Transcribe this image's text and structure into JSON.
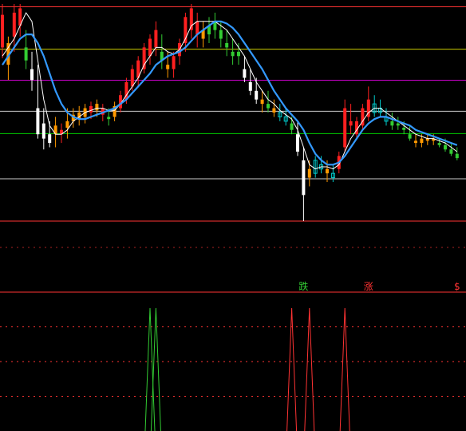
{
  "chart_data": [
    {
      "type": "candlestick",
      "panel": "main",
      "title": "",
      "xlabel": "",
      "ylabel": "",
      "ylim": [
        0,
        100
      ],
      "grid": false,
      "legend": "none",
      "colors": {
        "up": "#ff2020",
        "down": "#ffffff",
        "weak_up": "#ff9900",
        "weak_down": "#33cc33",
        "hollow": "#00cccc",
        "ma_fast": "#ffffff",
        "ma_slow": "#3399ff"
      },
      "reference_lines": [
        {
          "value": 98.7,
          "color": "#ff3333"
        },
        {
          "value": 79.2,
          "color": "#cccc00"
        },
        {
          "value": 64.9,
          "color": "#cc00cc"
        },
        {
          "value": 50.6,
          "color": "#cccccc"
        },
        {
          "value": 40.3,
          "color": "#00cc00"
        },
        {
          "value": 19.5,
          "color": "#cccccc"
        },
        {
          "value": 0.0,
          "color": "#ff3333"
        }
      ],
      "candles": [
        [
          0,
          80,
          100,
          75,
          95,
          "up"
        ],
        [
          1,
          72,
          85,
          65,
          82,
          "weak_up"
        ],
        [
          2,
          85,
          100,
          78,
          96,
          "up"
        ],
        [
          3,
          90,
          100,
          85,
          98,
          "up"
        ],
        [
          4,
          80,
          88,
          70,
          74,
          "weak_down"
        ],
        [
          5,
          70,
          78,
          60,
          65,
          "down"
        ],
        [
          6,
          52,
          72,
          38,
          40,
          "down"
        ],
        [
          7,
          45,
          52,
          33,
          38,
          "down"
        ],
        [
          8,
          40,
          46,
          34,
          36,
          "down"
        ],
        [
          9,
          40,
          48,
          34,
          44,
          "weak_up"
        ],
        [
          10,
          40,
          45,
          36,
          42,
          "up"
        ],
        [
          11,
          43,
          52,
          38,
          46,
          "weak_up"
        ],
        [
          12,
          46,
          52,
          43,
          49,
          "weak_up"
        ],
        [
          13,
          47,
          53,
          44,
          50,
          "weak_up"
        ],
        [
          14,
          48,
          54,
          45,
          52,
          "weak_up"
        ],
        [
          15,
          50,
          55,
          47,
          53,
          "up"
        ],
        [
          16,
          51,
          56,
          48,
          54,
          "weak_up"
        ],
        [
          17,
          49,
          54,
          46,
          52,
          "up"
        ],
        [
          18,
          47,
          52,
          44,
          48,
          "weak_down"
        ],
        [
          19,
          48,
          55,
          46,
          53,
          "weak_up"
        ],
        [
          20,
          52,
          60,
          50,
          58,
          "up"
        ],
        [
          21,
          56,
          66,
          54,
          64,
          "up"
        ],
        [
          22,
          62,
          72,
          60,
          70,
          "up"
        ],
        [
          23,
          66,
          76,
          62,
          74,
          "up"
        ],
        [
          24,
          70,
          82,
          68,
          80,
          "up"
        ],
        [
          25,
          76,
          86,
          72,
          84,
          "up"
        ],
        [
          26,
          80,
          92,
          76,
          88,
          "up"
        ],
        [
          27,
          78,
          86,
          70,
          74,
          "weak_down"
        ],
        [
          28,
          72,
          78,
          66,
          70,
          "weak_up"
        ],
        [
          29,
          70,
          78,
          66,
          76,
          "up"
        ],
        [
          30,
          76,
          84,
          72,
          82,
          "up"
        ],
        [
          31,
          82,
          96,
          78,
          94,
          "up"
        ],
        [
          32,
          88,
          100,
          84,
          98,
          "up"
        ],
        [
          33,
          86,
          96,
          80,
          92,
          "up"
        ],
        [
          34,
          84,
          92,
          80,
          88,
          "weak_up"
        ],
        [
          35,
          86,
          94,
          82,
          90,
          "weak_down"
        ],
        [
          36,
          88,
          96,
          84,
          92,
          "weak_down"
        ],
        [
          37,
          84,
          92,
          80,
          88,
          "weak_down"
        ],
        [
          38,
          82,
          88,
          76,
          80,
          "weak_down"
        ],
        [
          39,
          78,
          84,
          72,
          76,
          "weak_down"
        ],
        [
          40,
          76,
          82,
          72,
          78,
          "weak_down"
        ],
        [
          41,
          70,
          76,
          64,
          66,
          "down"
        ],
        [
          42,
          64,
          70,
          58,
          60,
          "down"
        ],
        [
          43,
          60,
          66,
          54,
          56,
          "down"
        ],
        [
          44,
          56,
          60,
          50,
          54,
          "weak_up"
        ],
        [
          45,
          54,
          60,
          50,
          52,
          "weak_down"
        ],
        [
          46,
          52,
          56,
          48,
          50,
          "weak_up"
        ],
        [
          47,
          50,
          54,
          46,
          48,
          "hollow"
        ],
        [
          48,
          48,
          52,
          44,
          46,
          "hollow"
        ],
        [
          49,
          45,
          48,
          40,
          42,
          "weak_down"
        ],
        [
          50,
          40,
          46,
          30,
          32,
          "down"
        ],
        [
          51,
          28,
          34,
          0,
          12,
          "down"
        ],
        [
          52,
          20,
          28,
          16,
          24,
          "weak_up"
        ],
        [
          53,
          22,
          30,
          20,
          28,
          "hollow"
        ],
        [
          54,
          24,
          30,
          22,
          26,
          "hollow"
        ],
        [
          55,
          22,
          28,
          18,
          24,
          "weak_up"
        ],
        [
          56,
          20,
          26,
          18,
          22,
          "hollow"
        ],
        [
          57,
          24,
          32,
          22,
          30,
          "up"
        ],
        [
          58,
          34,
          56,
          32,
          52,
          "up"
        ],
        [
          59,
          46,
          54,
          40,
          44,
          "up"
        ],
        [
          60,
          40,
          48,
          38,
          46,
          "up"
        ],
        [
          61,
          44,
          54,
          42,
          52,
          "up"
        ],
        [
          62,
          48,
          62,
          46,
          56,
          "up"
        ],
        [
          63,
          50,
          58,
          48,
          54,
          "hollow"
        ],
        [
          64,
          52,
          56,
          48,
          50,
          "hollow"
        ],
        [
          65,
          48,
          52,
          44,
          46,
          "hollow"
        ],
        [
          66,
          46,
          50,
          42,
          44,
          "weak_down"
        ],
        [
          67,
          44,
          48,
          42,
          45,
          "weak_down"
        ],
        [
          68,
          42,
          46,
          40,
          43,
          "weak_down"
        ],
        [
          69,
          40,
          44,
          37,
          38,
          "weak_down"
        ],
        [
          70,
          36,
          40,
          34,
          37,
          "weak_up"
        ],
        [
          71,
          36,
          40,
          34,
          38,
          "weak_up"
        ],
        [
          72,
          37,
          40,
          35,
          38,
          "weak_up"
        ],
        [
          73,
          37,
          40,
          35,
          38,
          "weak_up"
        ],
        [
          74,
          36,
          38,
          34,
          35,
          "weak_down"
        ],
        [
          75,
          35,
          38,
          32,
          33,
          "weak_down"
        ],
        [
          76,
          33,
          36,
          30,
          31,
          "weak_down"
        ],
        [
          77,
          31,
          34,
          28,
          29,
          "weak_down"
        ]
      ],
      "ma_fast": [
        76,
        80,
        84,
        90,
        96,
        92,
        74,
        56,
        44,
        40,
        40,
        42,
        46,
        48,
        50,
        51,
        52,
        52,
        51,
        51,
        54,
        58,
        62,
        66,
        72,
        76,
        80,
        80,
        78,
        77,
        79,
        84,
        90,
        92,
        92,
        92,
        92,
        90,
        88,
        84,
        80,
        76,
        70,
        64,
        60,
        56,
        54,
        51,
        49,
        47,
        42,
        34,
        26,
        24,
        25,
        25,
        24,
        26,
        32,
        38,
        42,
        46,
        50,
        52,
        52,
        50,
        48,
        46,
        44,
        42,
        40,
        39,
        38,
        38,
        37,
        36,
        34,
        32
      ],
      "ma_slow": [
        72,
        76,
        80,
        84,
        86,
        86,
        82,
        76,
        68,
        60,
        54,
        50,
        48,
        47,
        47,
        48,
        49,
        50,
        51,
        52,
        54,
        56,
        59,
        62,
        65,
        68,
        72,
        74,
        76,
        77,
        78,
        80,
        83,
        86,
        88,
        90,
        92,
        92,
        91,
        89,
        86,
        82,
        78,
        74,
        70,
        65,
        60,
        56,
        52,
        49,
        46,
        42,
        36,
        31,
        28,
        26,
        26,
        27,
        30,
        34,
        38,
        42,
        45,
        47,
        48,
        48,
        47,
        46,
        45,
        44,
        42,
        41,
        40,
        39,
        38,
        37,
        36,
        35
      ]
    },
    {
      "type": "signal_markers",
      "panel": "main",
      "markers": [
        {
          "index": 51,
          "label": "跌",
          "color": "#33cc33"
        },
        {
          "index": 62,
          "label": "涨",
          "color": "#ff3333"
        },
        {
          "index": 77,
          "label": "$",
          "color": "#ff3333"
        }
      ]
    },
    {
      "type": "line",
      "panel": "indicator",
      "title": "",
      "xlabel": "",
      "ylabel": "",
      "ylim": [
        0,
        100
      ],
      "grid": false,
      "reference_lines": [
        {
          "value": 0.0,
          "color": "#ff3333"
        },
        {
          "value": 0.25,
          "color": "#ff3333",
          "dashed": true
        },
        {
          "value": 0.5,
          "color": "#ff3333",
          "dashed": true
        },
        {
          "value": 0.75,
          "color": "#ff3333",
          "dashed": true
        }
      ],
      "spikes": [
        {
          "index": 25,
          "value": 100,
          "color": "#33cc33"
        },
        {
          "index": 26,
          "value": 100,
          "color": "#33cc33"
        },
        {
          "index": 49,
          "value": 100,
          "color": "#ff3333"
        },
        {
          "index": 52,
          "value": 100,
          "color": "#ff3333"
        },
        {
          "index": 58,
          "value": 100,
          "color": "#ff3333"
        }
      ]
    }
  ]
}
